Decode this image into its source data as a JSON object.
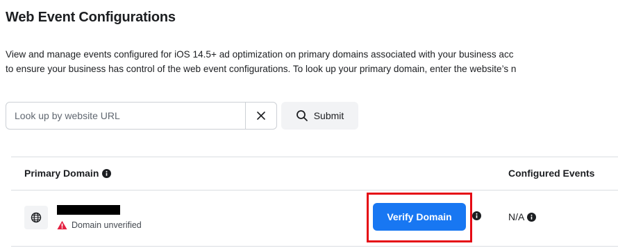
{
  "page": {
    "title": "Web Event Configurations",
    "description_line1": "View and manage events configured for iOS 14.5+ ad optimization on primary domains associated with your business acc",
    "description_line2": "to ensure your business has control of the web event configurations. To look up your primary domain, enter the website’s n"
  },
  "search": {
    "placeholder": "Look up by website URL",
    "value": "",
    "clear_icon": "close-icon",
    "submit_label": "Submit",
    "submit_icon": "search-icon"
  },
  "table": {
    "columns": {
      "primary_domain": "Primary Domain",
      "configured_events": "Configured Events"
    },
    "rows": [
      {
        "domain_icon": "globe-icon",
        "domain": "",
        "status": "Domain unverified",
        "status_icon": "warning-icon",
        "action_label": "Verify Domain",
        "configured_events": "N/A"
      }
    ]
  },
  "colors": {
    "accent": "#1877f2",
    "warning": "#e41e3f",
    "highlight": "#e50914"
  }
}
